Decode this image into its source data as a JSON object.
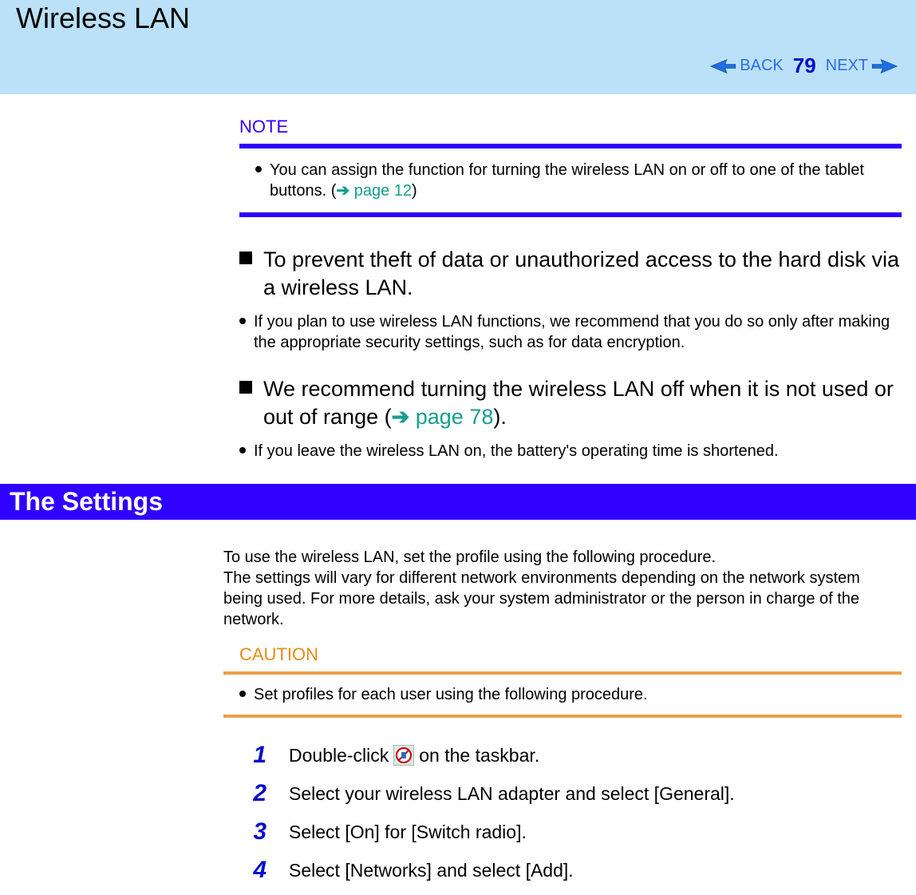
{
  "header": {
    "title": "Wireless LAN",
    "nav": {
      "back": "BACK",
      "page": "79",
      "next": "NEXT"
    }
  },
  "note": {
    "label": "NOTE",
    "item_pre": "You can assign the function for turning the wireless LAN on or off to one of the tablet buttons. (",
    "arrow": "➔",
    "link": "page 12",
    "item_post": ")"
  },
  "subhead1": {
    "text": "To prevent theft of data or unauthorized access to the hard disk via a wireless LAN.",
    "bullet": " If you plan to use wireless LAN functions, we recommend that you do so only after making the appropriate security settings, such as for data encryption."
  },
  "subhead2": {
    "text_pre": "We recommend turning the wireless LAN off when it is not used or out of range (",
    "arrow": "➔",
    "link": "page 78",
    "text_post": ").",
    "bullet": "If you leave the wireless LAN on, the battery's operating time is shortened."
  },
  "section_title": "The Settings",
  "settings_para_line1": "To use the wireless LAN, set the profile using the following procedure.",
  "settings_para_line2": "The settings will vary for different network environments depending on the network system being used. For more details, ask your system administrator or the person in charge of the network.",
  "caution": {
    "label": "CAUTION",
    "item": "Set profiles for each user using the following procedure."
  },
  "steps": [
    {
      "num": "1",
      "pre": "Double-click ",
      "post": " on the taskbar."
    },
    {
      "num": "2",
      "text": "Select your wireless LAN adapter and select [General]."
    },
    {
      "num": "3",
      "text": "Select [On] for [Switch radio]."
    },
    {
      "num": "4",
      "text": "Select [Networks] and select [Add]."
    }
  ]
}
